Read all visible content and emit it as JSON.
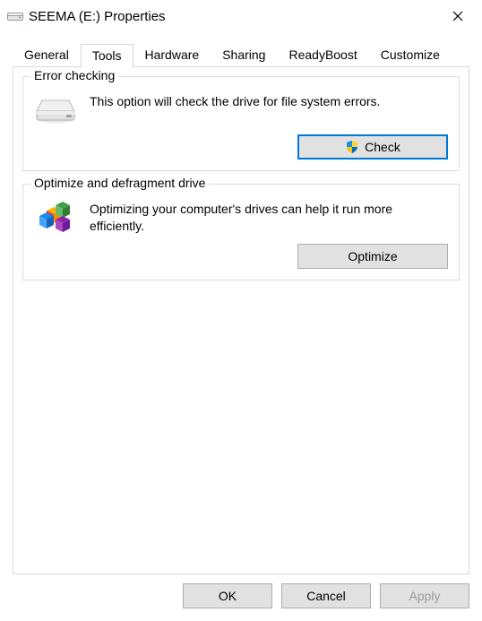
{
  "window": {
    "title": "SEEMA (E:) Properties"
  },
  "tabs": {
    "items": [
      "General",
      "Tools",
      "Hardware",
      "Sharing",
      "ReadyBoost",
      "Customize"
    ],
    "active_index": 1
  },
  "tools": {
    "error_checking": {
      "title": "Error checking",
      "description": "This option will check the drive for file system errors.",
      "button_label": "Check"
    },
    "optimize": {
      "title": "Optimize and defragment drive",
      "description": "Optimizing your computer's drives can help it run more efficiently.",
      "button_label": "Optimize"
    }
  },
  "buttons": {
    "ok": "OK",
    "cancel": "Cancel",
    "apply": "Apply"
  },
  "icons": {
    "close": "close-icon",
    "drive": "drive-icon",
    "shield": "uac-shield-icon",
    "defrag": "defrag-blocks-icon"
  },
  "colors": {
    "accent": "#0078d7",
    "button_face": "#e1e1e1",
    "button_border": "#adadad",
    "groupbox_border": "#dcdcdc",
    "disabled_text": "#9b9b9b"
  }
}
